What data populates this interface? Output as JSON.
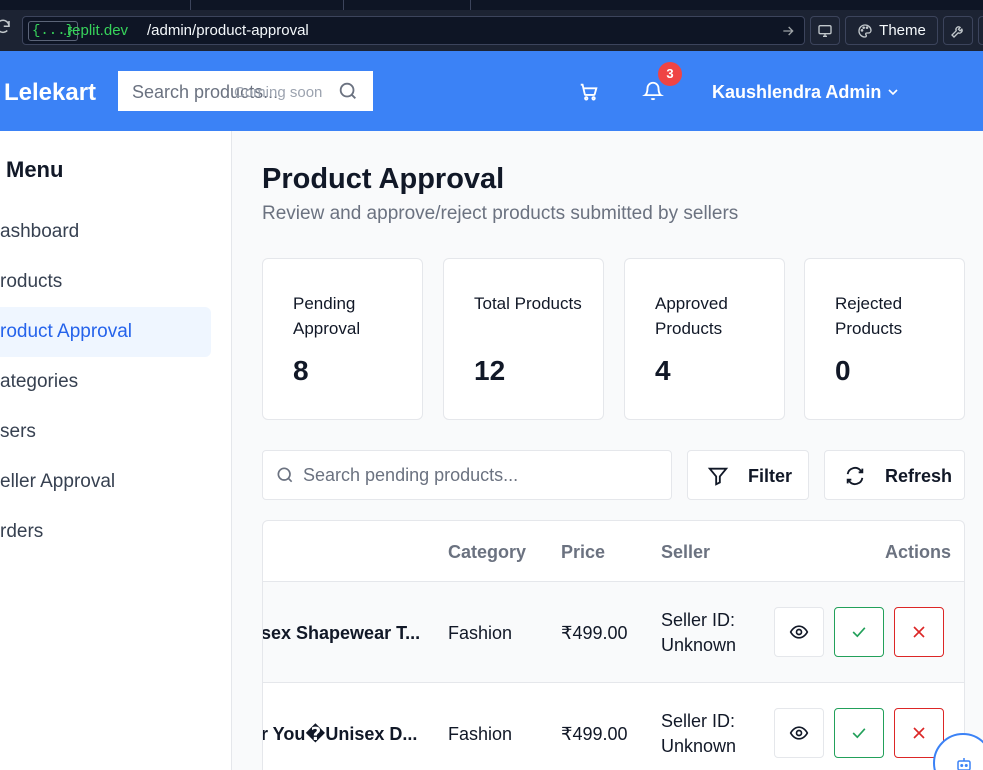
{
  "browser": {
    "badge": "{...}",
    "host": ".replit.dev",
    "path": "/admin/product-approval",
    "theme_label": "Theme"
  },
  "header": {
    "logo": "Lelekart",
    "search_placeholder": "Search products...",
    "search_note": "Coming soon",
    "notification_count": "3",
    "user_name": "Kaushlendra Admin"
  },
  "sidebar": {
    "title": "Menu",
    "items": [
      {
        "label": "ashboard"
      },
      {
        "label": "roducts"
      },
      {
        "label": "roduct Approval"
      },
      {
        "label": "ategories"
      },
      {
        "label": "sers"
      },
      {
        "label": "eller Approval"
      },
      {
        "label": "rders"
      }
    ]
  },
  "page": {
    "title": "Product Approval",
    "subtitle": "Review and approve/reject products submitted by sellers"
  },
  "stats": [
    {
      "label": "Pending Approval",
      "value": "8"
    },
    {
      "label": "Total Products",
      "value": "12"
    },
    {
      "label": "Approved Products",
      "value": "4"
    },
    {
      "label": "Rejected Products",
      "value": "0"
    }
  ],
  "toolbar": {
    "search_placeholder": "Search pending products...",
    "filter_label": "Filter",
    "refresh_label": "Refresh"
  },
  "table": {
    "columns": {
      "category": "Category",
      "price": "Price",
      "seller": "Seller",
      "actions": "Actions"
    },
    "rows": [
      {
        "name": "sex Shapewear T...",
        "category": "Fashion",
        "price": "₹499.00",
        "seller_line1": "Seller ID:",
        "seller_line2": "Unknown"
      },
      {
        "name": "r You�Unisex D...",
        "category": "Fashion",
        "price": "₹499.00",
        "seller_line1": "Seller ID:",
        "seller_line2": "Unknown"
      }
    ]
  },
  "colors": {
    "brand_blue": "#3b82f6",
    "active_nav": "#2563eb",
    "approve_green": "#22a05a",
    "reject_red": "#dc2626",
    "badge_red": "#ef4444"
  }
}
